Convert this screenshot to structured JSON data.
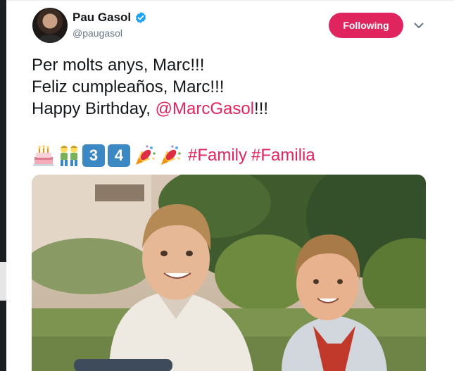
{
  "tweet": {
    "author": {
      "display_name": "Pau Gasol",
      "handle": "@paugasol",
      "verified": true,
      "avatar_icon": "profile-photo"
    },
    "follow_button_label": "Following",
    "menu_icon": "chevron-down-icon",
    "text_lines": [
      {
        "text": "Per molts anys, Marc!!!"
      },
      {
        "text": "Feliz cumpleaños, Marc!!!"
      },
      {
        "before": "Happy Birthday, ",
        "mention": "@MarcGasol",
        "after": "!!!"
      }
    ],
    "emojis": {
      "cake": "birthday-cake-emoji",
      "boys": "two-boys-emoji",
      "keycap_3": "3",
      "keycap_4": "4",
      "party_1": "party-popper-emoji",
      "party_2": "party-popper-emoji"
    },
    "hashtags": [
      "#Family",
      "#Familia"
    ],
    "media": {
      "type": "photo",
      "subject": "two-boys-childhood-photo"
    }
  },
  "colors": {
    "accent": "#e0245e",
    "verified_blue": "#1da1f2",
    "secondary_text": "#657786",
    "keycap_blue": "#3b88c3"
  }
}
